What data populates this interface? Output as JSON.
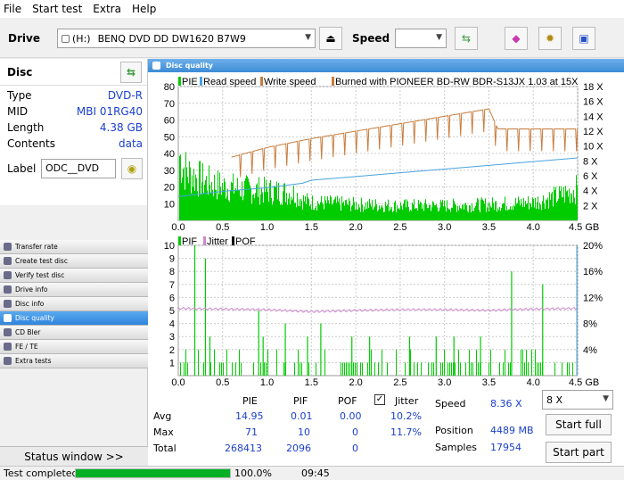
{
  "menu": [
    "File",
    "Start test",
    "Extra",
    "Help"
  ],
  "toolbar": {
    "drive_label": "Drive",
    "drive_letter": "(H:)",
    "drive_name": "BENQ DVD DD DW1620 B7W9",
    "speed_label": "Speed",
    "speed_value": ""
  },
  "disc": {
    "title": "Disc",
    "type_k": "Type",
    "type_v": "DVD-R",
    "mid_k": "MID",
    "mid_v": "MBI 01RG40",
    "length_k": "Length",
    "length_v": "4.38 GB",
    "contents_k": "Contents",
    "contents_v": "data",
    "label_k": "Label",
    "label_v": "ODC__DVD"
  },
  "nav": [
    "Transfer rate",
    "Create test disc",
    "Verify test disc",
    "Drive info",
    "Disc info",
    "Disc quality",
    "CD Bler",
    "FE / TE",
    "Extra tests"
  ],
  "status_window": "Status window >>",
  "statusbar": {
    "text": "Test completed",
    "progress": 1.0,
    "percent": "100.0%",
    "time": "09:45"
  },
  "panel_title": "Disc quality",
  "colors": {
    "pie": "#00cc00",
    "read": "#4aa3e0",
    "write": "#c87c3c",
    "jitter": "#cc88cc",
    "pif": "#00cc00"
  },
  "chart_data": [
    {
      "type": "bar",
      "legend": [
        "PIE",
        "Read speed",
        "Write speed",
        "Burned with PIONEER BD-RW  BDR-S13JX 1.03 at 15X"
      ],
      "xlim": [
        0,
        4.5
      ],
      "ylim": [
        0,
        80
      ],
      "y2lim": [
        0,
        18
      ],
      "x_ticks": [
        "0.0",
        "0.5",
        "1.0",
        "1.5",
        "2.0",
        "2.5",
        "3.0",
        "3.5",
        "4.0",
        "4.5 GB"
      ],
      "y_ticks": [
        "10",
        "20",
        "30",
        "40",
        "50",
        "60",
        "70",
        "80"
      ],
      "y2_ticks": [
        "2 X",
        "4 X",
        "6 X",
        "8 X",
        "10 X",
        "12 X",
        "14 X",
        "16 X",
        "18 X"
      ],
      "pie_envelope": {
        "x": [
          0,
          0.05,
          0.1,
          0.2,
          0.3,
          0.5,
          0.7,
          1.0,
          1.3,
          1.4,
          1.5,
          2.0,
          2.5,
          3.0,
          3.5,
          4.0,
          4.3,
          4.5
        ],
        "y": [
          60,
          48,
          42,
          38,
          34,
          30,
          28,
          26,
          24,
          18,
          16,
          14,
          13,
          13,
          14,
          16,
          22,
          28
        ]
      },
      "read_speed": {
        "x": [
          0,
          0.5,
          1.0,
          1.4,
          1.5,
          2.0,
          2.5,
          3.0,
          3.5,
          4.0,
          4.5
        ],
        "y": [
          3.2,
          3.9,
          4.4,
          5.0,
          5.4,
          5.9,
          6.4,
          6.9,
          7.4,
          7.9,
          8.4
        ]
      },
      "write_speed": {
        "x": [
          0.6,
          1.0,
          1.5,
          2.0,
          2.5,
          3.0,
          3.5,
          3.6,
          4.0,
          4.5
        ],
        "y": [
          8.5,
          9.8,
          11.0,
          12.0,
          13.0,
          14.0,
          15.0,
          12.3,
          12.3,
          12.3
        ]
      }
    },
    {
      "type": "bar",
      "legend": [
        "PIF",
        "Jitter",
        "POF"
      ],
      "xlim": [
        0,
        4.5
      ],
      "ylim": [
        0,
        10
      ],
      "y2lim": [
        0,
        20
      ],
      "x_ticks": [
        "0.0",
        "0.5",
        "1.0",
        "1.5",
        "2.0",
        "2.5",
        "3.0",
        "3.5",
        "4.0",
        "4.5 GB"
      ],
      "y_ticks": [
        "1",
        "2",
        "3",
        "4",
        "5",
        "6",
        "7",
        "8",
        "9",
        "10"
      ],
      "y2_ticks": [
        "4%",
        "8%",
        "12%",
        "16%",
        "20%"
      ],
      "jitter": {
        "x": [
          0,
          0.5,
          1.0,
          1.5,
          2.0,
          2.5,
          3.0,
          3.5,
          4.0,
          4.5
        ],
        "y": [
          10.4,
          10.3,
          10.2,
          9.9,
          10.1,
          10.2,
          10.2,
          10.1,
          10.3,
          10.4
        ]
      },
      "pif_spikes": {
        "x": [
          0.18,
          0.3,
          0.35,
          0.9,
          0.95,
          1.2,
          1.45,
          1.6,
          1.95,
          2.15,
          2.6,
          2.9,
          3.1,
          3.4,
          3.75,
          4.1
        ],
        "y": [
          10,
          9,
          3,
          5,
          3,
          4,
          3,
          4,
          3,
          3,
          3,
          3,
          3,
          3,
          8,
          7
        ]
      }
    }
  ],
  "stats": {
    "headers": [
      "PIE",
      "PIF",
      "POF",
      "Jitter"
    ],
    "rows": [
      {
        "label": "Avg",
        "pie": "14.95",
        "pif": "0.01",
        "pof": "0.00",
        "jitter": "10.2%"
      },
      {
        "label": "Max",
        "pie": "71",
        "pif": "10",
        "pof": "0",
        "jitter": "11.7%"
      },
      {
        "label": "Total",
        "pie": "268413",
        "pif": "2096",
        "pof": "0",
        "jitter": ""
      }
    ],
    "speed_k": "Speed",
    "speed_v": "8.36 X",
    "position_k": "Position",
    "position_v": "4489 MB",
    "samples_k": "Samples",
    "samples_v": "17954",
    "speed_select": "8 X",
    "start_full": "Start full",
    "start_part": "Start part"
  }
}
